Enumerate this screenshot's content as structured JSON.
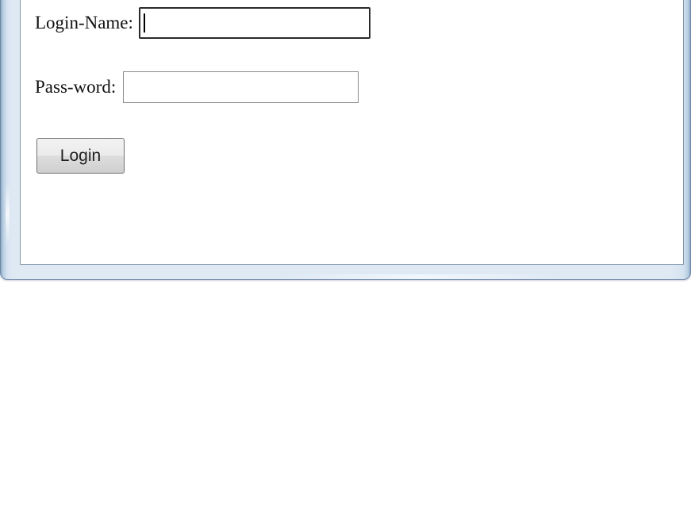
{
  "form": {
    "login_name_label": "Login-Name:",
    "login_name_value": "",
    "password_label": "Pass-word:",
    "password_value": "",
    "login_button_label": "Login"
  }
}
